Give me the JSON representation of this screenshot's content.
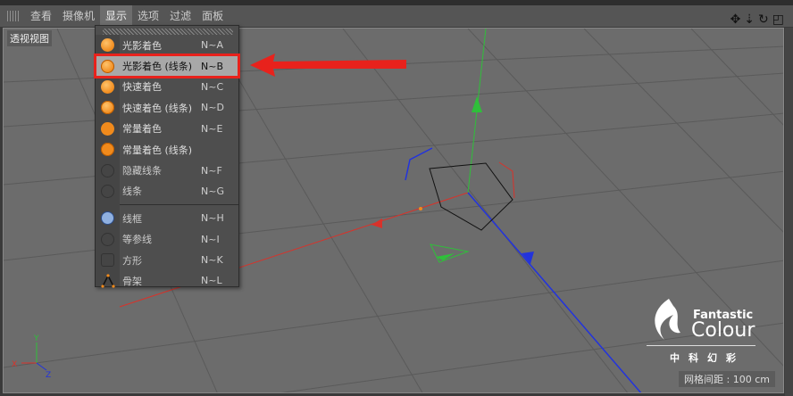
{
  "menubar": {
    "items": [
      "查看",
      "摄像机",
      "显示",
      "选项",
      "过滤",
      "面板"
    ],
    "active": "显示"
  },
  "viewport": {
    "label": "透视视图",
    "grid_spacing": "网格间距 : 100 cm",
    "axes": {
      "x": "X",
      "y": "Y",
      "z": "Z"
    }
  },
  "display_menu": {
    "items": [
      {
        "label": "光影着色",
        "shortcut": "N~A",
        "icon": "shaded-ball-icon"
      },
      {
        "label": "光影着色 (线条)",
        "shortcut": "N~B",
        "icon": "shaded-lines-ball-icon",
        "highlighted": true
      },
      {
        "label": "快速着色",
        "shortcut": "N~C",
        "icon": "quick-ball-icon"
      },
      {
        "label": "快速着色 (线条)",
        "shortcut": "N~D",
        "icon": "quick-lines-ball-icon"
      },
      {
        "label": "常量着色",
        "shortcut": "N~E",
        "icon": "constant-ball-icon"
      },
      {
        "label": "常量着色 (线条)",
        "shortcut": "",
        "icon": "constant-lines-ball-icon"
      },
      {
        "label": "隐藏线条",
        "shortcut": "N~F",
        "icon": "hidden-line-icon"
      },
      {
        "label": "线条",
        "shortcut": "N~G",
        "icon": "lines-icon"
      },
      {
        "label": "线框",
        "shortcut": "N~H",
        "icon": "wireframe-icon"
      },
      {
        "label": "等参线",
        "shortcut": "N~I",
        "icon": "isoparm-icon"
      },
      {
        "label": "方形",
        "shortcut": "N~K",
        "icon": "box-icon"
      },
      {
        "label": "骨架",
        "shortcut": "N~L",
        "icon": "skeleton-icon"
      }
    ]
  },
  "logo": {
    "brand_en_1": "Fantastic",
    "brand_en_2": "Colour",
    "brand_cn": "中科幻彩"
  },
  "colors": {
    "highlight_border": "#e8221c",
    "arrow": "#e8221c",
    "x_axis": "#d9322a",
    "y_axis": "#2fbf3a",
    "z_axis": "#2233dd"
  }
}
